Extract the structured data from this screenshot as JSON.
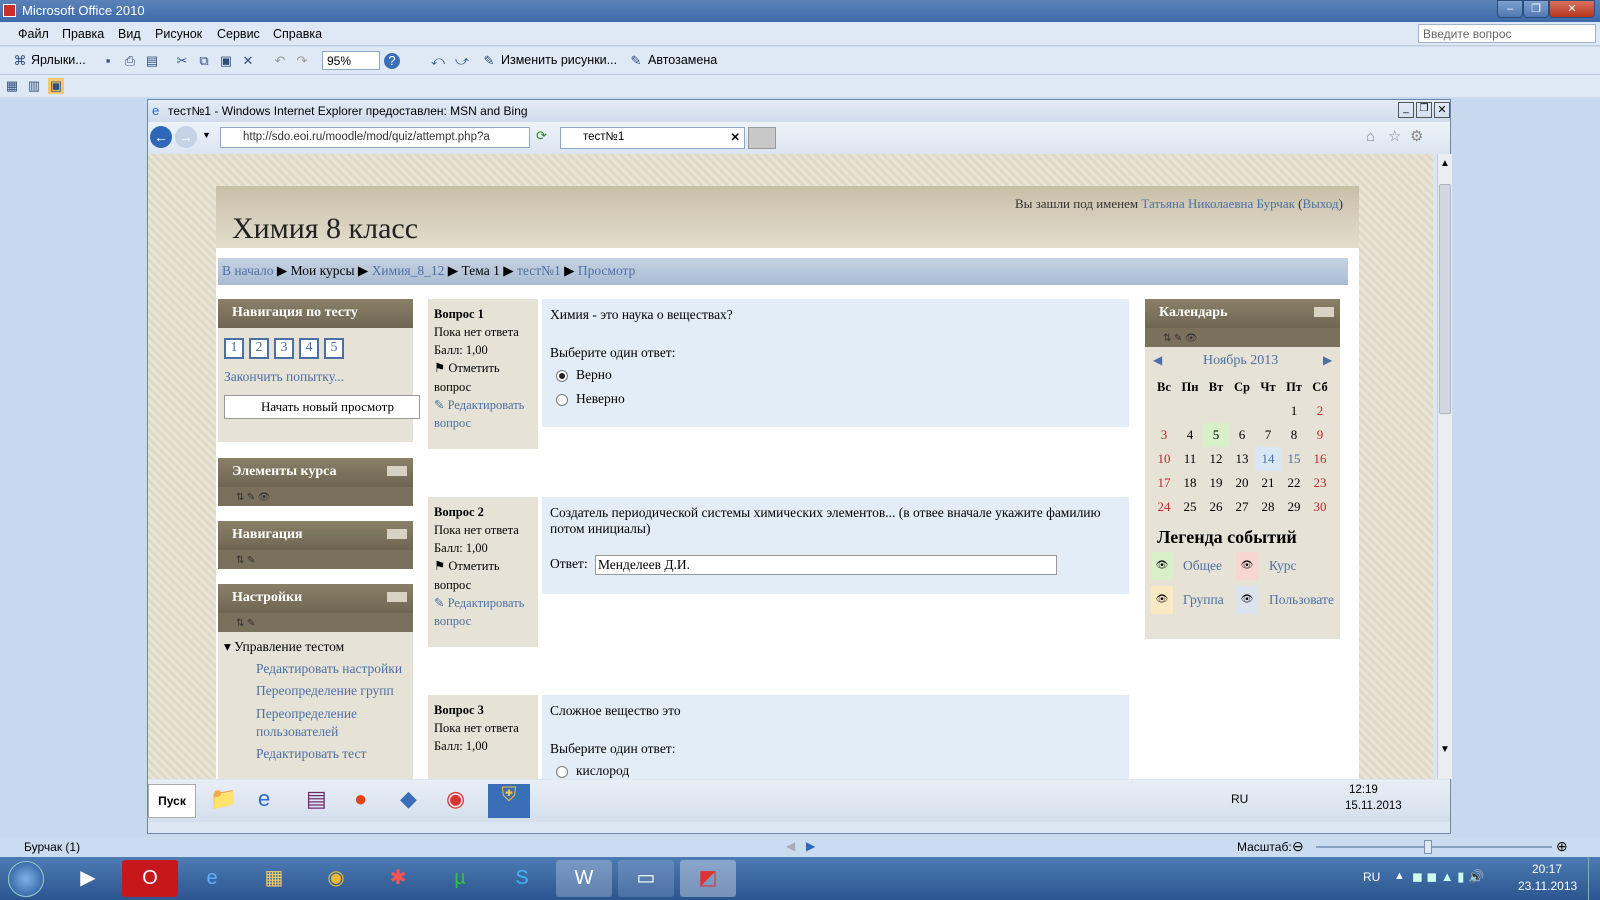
{
  "window": {
    "title": "Microsoft Office 2010"
  },
  "menu": [
    "Файл",
    "Правка",
    "Вид",
    "Рисунок",
    "Сервис",
    "Справка"
  ],
  "ask_placeholder": "Введите вопрос",
  "toolbar": {
    "shortcuts": "Ярлыки...",
    "zoom": "95%",
    "change_pictures": "Изменить рисунки...",
    "autocorrect": "Автозамена"
  },
  "ie": {
    "title": "тест№1 - Windows Internet Explorer предоставлен: MSN and Bing",
    "url": "http://sdo.eoi.ru/moodle/mod/quiz/attempt.php?a",
    "tab": "тест№1"
  },
  "moodle": {
    "course_title": "Химия 8 класс",
    "login_prefix": "Вы зашли под именем ",
    "user_name": "Татьяна Николаевна Бурчак",
    "logout": "Выход",
    "breadcrumb": [
      "В начало",
      "Мои курсы",
      "Химия_8_12",
      "Тема 1",
      "тест№1",
      "Просмотр"
    ],
    "nav_block": {
      "title": "Навигация по тесту",
      "questions": [
        "1",
        "2",
        "3",
        "4",
        "5"
      ],
      "finish": "Закончить попытку...",
      "new_preview": "Начать новый просмотр"
    },
    "elements_block": {
      "title": "Элементы курса"
    },
    "navigation_block": {
      "title": "Навигация"
    },
    "settings_block": {
      "title": "Настройки",
      "group": "Управление тестом",
      "items": [
        "Редактировать настройки",
        "Переопределение групп",
        "Переопределение пользователей",
        "Редактировать тест"
      ]
    },
    "questions": [
      {
        "label": "Вопрос",
        "num": "1",
        "status": "Пока нет ответа",
        "score": "Балл: 1,00",
        "flag": "Отметить вопрос",
        "edit": "Редактировать вопрос",
        "text": "Химия - это наука о веществах?",
        "prompt": "Выберите один ответ:",
        "options": [
          "Верно",
          "Неверно"
        ],
        "selected": 0
      },
      {
        "label": "Вопрос",
        "num": "2",
        "status": "Пока нет ответа",
        "score": "Балл: 1,00",
        "flag": "Отметить вопрос",
        "edit": "Редактировать вопрос",
        "text": "Создатель периодической системы химических элементов... (в отвее вначале укажите фамилию потом инициалы)",
        "answer_label": "Ответ:",
        "answer_value": "Менделеев Д.И."
      },
      {
        "label": "Вопрос",
        "num": "3",
        "status": "Пока нет ответа",
        "score": "Балл: 1,00",
        "text": "Сложное вещество это",
        "prompt": "Выберите один ответ:",
        "options": [
          "кислород"
        ]
      }
    ],
    "calendar": {
      "title": "Календарь",
      "month": "Ноябрь 2013",
      "weekdays": [
        "Вс",
        "Пн",
        "Вт",
        "Ср",
        "Чт",
        "Пт",
        "Сб"
      ],
      "weeks": [
        [
          "",
          "",
          "",
          "",
          "",
          "1",
          "2"
        ],
        [
          "3",
          "4",
          "5",
          "6",
          "7",
          "8",
          "9"
        ],
        [
          "10",
          "11",
          "12",
          "13",
          "14",
          "15",
          "16"
        ],
        [
          "17",
          "18",
          "19",
          "20",
          "21",
          "22",
          "23"
        ],
        [
          "24",
          "25",
          "26",
          "27",
          "28",
          "29",
          "30"
        ]
      ],
      "today": "5",
      "highlight": "14",
      "legend_title": "Легенда событий",
      "legend": [
        "Общее",
        "Курс",
        "Группа",
        "Пользовате"
      ]
    }
  },
  "inner_tray": {
    "lang": "RU",
    "time": "12:19",
    "date": "15.11.2013",
    "start": "Пуск"
  },
  "word_status": {
    "author": "Бурчак (1)",
    "scale_label": "Масштаб:"
  },
  "tray": {
    "lang": "RU",
    "time": "20:17",
    "date": "23.11.2013"
  }
}
